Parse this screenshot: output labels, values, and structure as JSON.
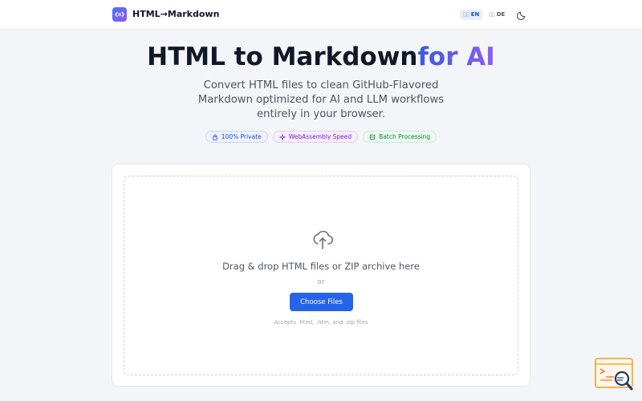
{
  "header": {
    "brand": "HTML→Markdown",
    "lang_en": "EN",
    "lang_de": "DE",
    "lang_flag_glyph": "▯▯",
    "theme_icon": "moon-icon"
  },
  "hero": {
    "title_main": "HTML to Markdown",
    "title_accent": "for AI",
    "subtitle": "Convert HTML files to clean GitHub-Flavored Markdown optimized for AI and LLM workflows entirely in your browser."
  },
  "badges": [
    {
      "label": "100% Private",
      "icon": "lock-icon",
      "color": "#1d4ed8"
    },
    {
      "label": "WebAssembly Speed",
      "icon": "sparkle-icon",
      "color": "#7e22ce"
    },
    {
      "label": "Batch Processing",
      "icon": "database-icon",
      "color": "#15803d"
    }
  ],
  "dropzone": {
    "icon": "cloud-upload-icon",
    "text": "Drag & drop HTML files or ZIP archive here",
    "or": "or",
    "button": "Choose Files",
    "accepts": "Accepts .html, .htm, and .zip files"
  },
  "colors": {
    "primary": "#2563eb",
    "accent_start": "#3b5bdb",
    "accent_end": "#8b5cf6"
  }
}
